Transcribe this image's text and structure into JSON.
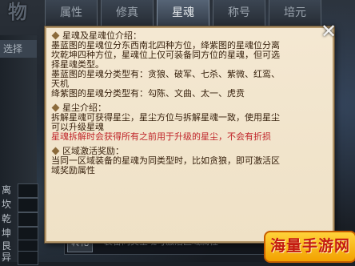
{
  "header": {
    "logo_text": "物",
    "tabs": [
      {
        "label": "属性",
        "active": false
      },
      {
        "label": "修真",
        "active": false
      },
      {
        "label": "星魂",
        "active": true
      },
      {
        "label": "称号",
        "active": false
      },
      {
        "label": "培元",
        "active": false
      }
    ]
  },
  "left_panel": {
    "top_label": "选择",
    "stats": [
      {
        "label": "离"
      },
      {
        "label": "坎"
      },
      {
        "label": "乾"
      },
      {
        "label": "坤"
      },
      {
        "label": "艮"
      },
      {
        "label": "异"
      }
    ]
  },
  "bottom": {
    "button_label": "转化",
    "status_text": "装备同类星魂可激活区域属性"
  },
  "tooltip": {
    "sections": [
      {
        "title": "星魂及星魂位介绍：",
        "lines": [
          {
            "text": "墨蓝图的星魂位分东西南北四种方位，绛紫图的星魂位分离",
            "warn": false
          },
          {
            "text": "坎乾坤四种方位，星魂位上仅可装备同方位的星魂，但可选",
            "warn": false
          },
          {
            "text": "择星魂类型。",
            "warn": false
          },
          {
            "text": "墨蓝图的星魂分类型有：贪狼、破军、七杀、紫微、红鸾、",
            "warn": false
          },
          {
            "text": "天机",
            "warn": false
          },
          {
            "text": "绛紫图的星魂分类型有：勾陈、文曲、太一、虎贲",
            "warn": false
          }
        ]
      },
      {
        "title": "星尘介绍：",
        "lines": [
          {
            "text": "拆解星魂可获得星尘，星尘方位与拆解星魂一致，使用星尘",
            "warn": false
          },
          {
            "text": "可以升级星魂",
            "warn": false
          },
          {
            "text": "星魂拆解时会获得所有之前用于升级的星尘，不会有折损",
            "warn": true
          }
        ]
      },
      {
        "title": "区域激活奖励：",
        "lines": [
          {
            "text": "当同一区域装备的星魂为同类型时，比如贪狼，即可激活区",
            "warn": false
          },
          {
            "text": "域奖励属性",
            "warn": false
          }
        ]
      }
    ]
  },
  "close_icon": "close-icon",
  "watermark": {
    "text": "海量手游网"
  },
  "colors": {
    "tooltip_bg": "#f4e8d2",
    "tooltip_text": "#3a2410",
    "warning_text": "#c0262b",
    "watermark_bg": "#ffd23a",
    "watermark_text": "#c41a10"
  }
}
